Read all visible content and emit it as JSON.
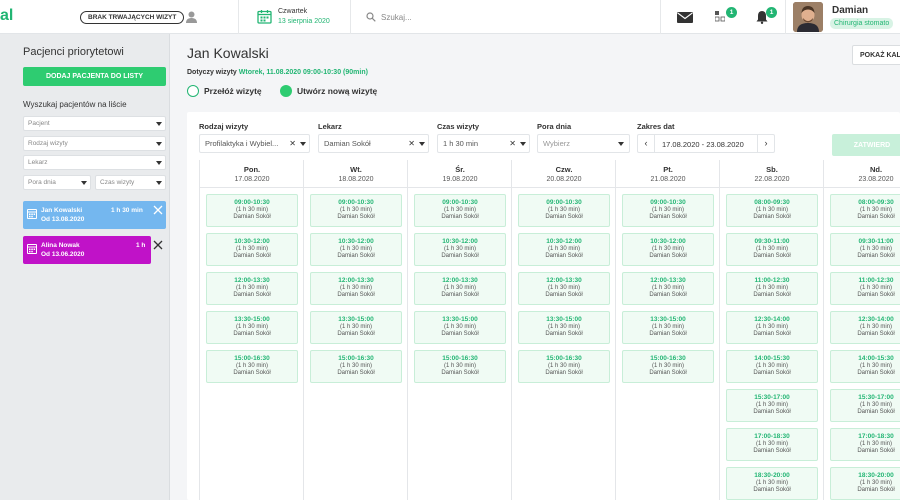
{
  "topbar": {
    "logo": "al",
    "no_visit_badge": "BRAK TRWAJĄCYCH WIZYT",
    "date_day": "Czwartek",
    "date_full": "13 sierpnia 2020",
    "search_placeholder": "Szukaj...",
    "apps_badge": "1",
    "bell_badge": "1",
    "user_name": "Damian",
    "user_role": "Chirurgia stomato"
  },
  "sidebar": {
    "title": "Pacjenci priorytetowi",
    "add_button": "DODAJ PACJENTA DO LISTY",
    "search_title": "Wyszukaj pacjentów na liście",
    "filters": {
      "patient": "Pacjent",
      "visit_type": "Rodzaj wizyty",
      "doctor": "Lekarz",
      "time_of_day": "Pora dnia",
      "visit_time": "Czas wizyty"
    },
    "patients": [
      {
        "name": "Jan Kowalski",
        "duration": "1 h 30 min",
        "date": "Od 13.08.2020",
        "color": "#74b7ef"
      },
      {
        "name": "Alina Nowak",
        "duration": "1 h",
        "date": "Od 13.06.2020",
        "color": "#c012c8"
      }
    ]
  },
  "main": {
    "patient_name": "Jan Kowalski",
    "show_calendar_button": "POKAŻ KAL",
    "visit_label": "Dotyczy wizyty",
    "visit_value": "Wtorek, 11.08.2020 09:00-10:30 (90min)",
    "radio_reschedule": "Przełóż wizytę",
    "radio_new": "Utwórz nową wizytę",
    "filters": {
      "visit_type_label": "Rodzaj wizyty",
      "visit_type_value": "Profilaktyka i Wybiel...",
      "doctor_label": "Lekarz",
      "doctor_value": "Damian Sokół",
      "visit_time_label": "Czas wizyty",
      "visit_time_value": "1 h 30 min",
      "time_of_day_label": "Pora dnia",
      "time_of_day_placeholder": "Wybierz",
      "date_range_label": "Zakres dat",
      "date_range_value": "17.08.2020 - 23.08.2020"
    },
    "confirm_button": "ZATWIERD",
    "days": [
      {
        "name": "Pon.",
        "date": "17.08.2020",
        "slots": [
          "09:00-10:30",
          "10:30-12:00",
          "12:00-13:30",
          "13:30-15:00",
          "15:00-16:30"
        ]
      },
      {
        "name": "Wt.",
        "date": "18.08.2020",
        "slots": [
          "09:00-10:30",
          "10:30-12:00",
          "12:00-13:30",
          "13:30-15:00",
          "15:00-16:30"
        ]
      },
      {
        "name": "Śr.",
        "date": "19.08.2020",
        "slots": [
          "09:00-10:30",
          "10:30-12:00",
          "12:00-13:30",
          "13:30-15:00",
          "15:00-16:30"
        ]
      },
      {
        "name": "Czw.",
        "date": "20.08.2020",
        "slots": [
          "09:00-10:30",
          "10:30-12:00",
          "12:00-13:30",
          "13:30-15:00",
          "15:00-16:30"
        ]
      },
      {
        "name": "Pt.",
        "date": "21.08.2020",
        "slots": [
          "09:00-10:30",
          "10:30-12:00",
          "12:00-13:30",
          "13:30-15:00",
          "15:00-16:30"
        ]
      },
      {
        "name": "Sb.",
        "date": "22.08.2020",
        "slots": [
          "08:00-09:30",
          "09:30-11:00",
          "11:00-12:30",
          "12:30-14:00",
          "14:00-15:30",
          "15:30-17:00",
          "17:00-18:30",
          "18:30-20:00"
        ]
      },
      {
        "name": "Nd.",
        "date": "23.08.2020",
        "slots": [
          "08:00-09:30",
          "09:30-11:00",
          "11:00-12:30",
          "12:30-14:00",
          "14:00-15:30",
          "15:30-17:00",
          "17:00-18:30",
          "18:30-20:00"
        ]
      }
    ],
    "slot_duration": "(1 h 30 min)",
    "slot_doctor": "Damian Sokół"
  },
  "colors": {
    "accent": "#22b573",
    "button": "#2ecc71"
  }
}
